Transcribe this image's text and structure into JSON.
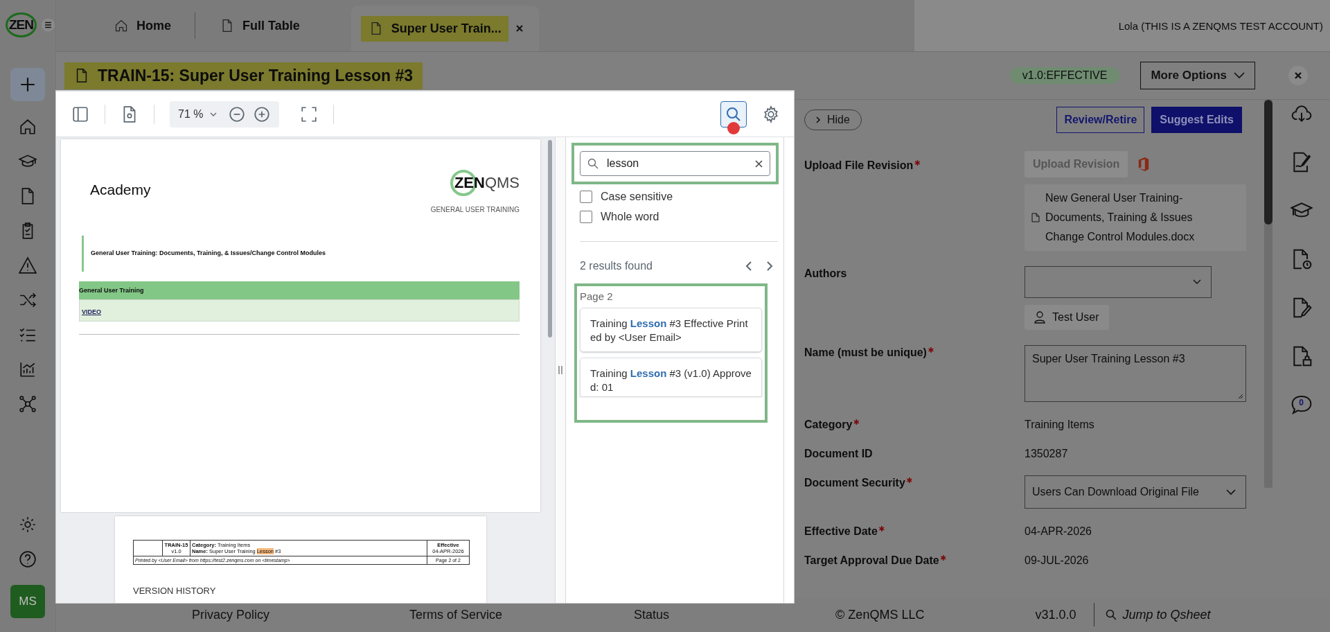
{
  "sidebar": {
    "logo": "ZEN",
    "avatar": "MS"
  },
  "tabs": [
    {
      "label": "Home",
      "selected": false
    },
    {
      "label": "Full Table",
      "selected": false
    },
    {
      "label": "Super User Train...",
      "selected": true
    }
  ],
  "account": "Lola (THIS IS A ZENQMS TEST ACCOUNT)",
  "document": {
    "title": "TRAIN-15: Super User Training Lesson #3",
    "status": "v1.0:EFFECTIVE",
    "more_options": "More Options"
  },
  "viewer": {
    "zoom": "71 %",
    "page_1": {
      "heading": "Academy",
      "logo_bold": "ZEN",
      "logo_light": "QMS",
      "logo_caption": "GENERAL USER TRAINING",
      "callout": "General User Training: Documents, Training, & Issues/Change Control Modules",
      "table_header": "General User Training",
      "link": "VIDEO"
    },
    "page_2": {
      "doc_id": "TRAIN-15",
      "version": "v1.0",
      "category": "**Category:** Training Items",
      "name_label": "Name:",
      "name_parts": [
        {
          "text": " Super User Training ",
          "match": false
        },
        {
          "text": "Lesson",
          "match": true
        },
        {
          "text": " #3",
          "match": false
        }
      ],
      "status": "Effective",
      "date": "04-APR-2026",
      "printed_by": "Printed by <User Email> from https://test2.zenqms.com on <timestamp>",
      "page": "Page 2 of 2",
      "section": "VERSION HISTORY"
    },
    "search": {
      "value": "lesson",
      "options": [
        {
          "label": "Case sensitive",
          "checked": false
        },
        {
          "label": "Whole word",
          "checked": false
        }
      ],
      "results_count": "2 results found",
      "page_label": "Page 2",
      "results": [
        {
          "text": "Training **Lesson** #3 Effective Printed by <User Email>"
        },
        {
          "text": "Training **Lesson** #3 (v1.0) Approved: 01"
        }
      ]
    }
  },
  "panel": {
    "hide": "Hide",
    "review": "Review/Retire",
    "suggest": "Suggest Edits",
    "fields": [
      {
        "label": "Upload File Revision",
        "required": true,
        "kind": "upload",
        "button": "Upload Revision",
        "file": "New General User Training- Documents, Training & Issues Change Control Modules.docx"
      },
      {
        "label": "Authors",
        "required": false,
        "kind": "users",
        "users": [
          "Test User"
        ]
      },
      {
        "label": "Name (must be unique)",
        "required": true,
        "kind": "textarea",
        "value": "Super User Training Lesson #3"
      },
      {
        "label": "Category",
        "required": true,
        "kind": "text",
        "value": "Training Items"
      },
      {
        "label": "Document ID",
        "required": false,
        "kind": "text",
        "value": "1350287"
      },
      {
        "label": "Document Security",
        "required": true,
        "kind": "select",
        "value": "Users Can Download Original File"
      },
      {
        "label": "Effective Date",
        "required": true,
        "kind": "text",
        "value": "04-APR-2026"
      },
      {
        "label": "Target Approval Due Date",
        "required": true,
        "kind": "text",
        "value": "09-JUL-2026"
      }
    ],
    "comments_count": "0"
  },
  "footer": {
    "links": [
      "Privacy Policy",
      "Terms of Service",
      "Status"
    ],
    "copyright": "© ZenQMS LLC",
    "version": "v31.0.0",
    "jump": "Jump to Qsheet"
  }
}
